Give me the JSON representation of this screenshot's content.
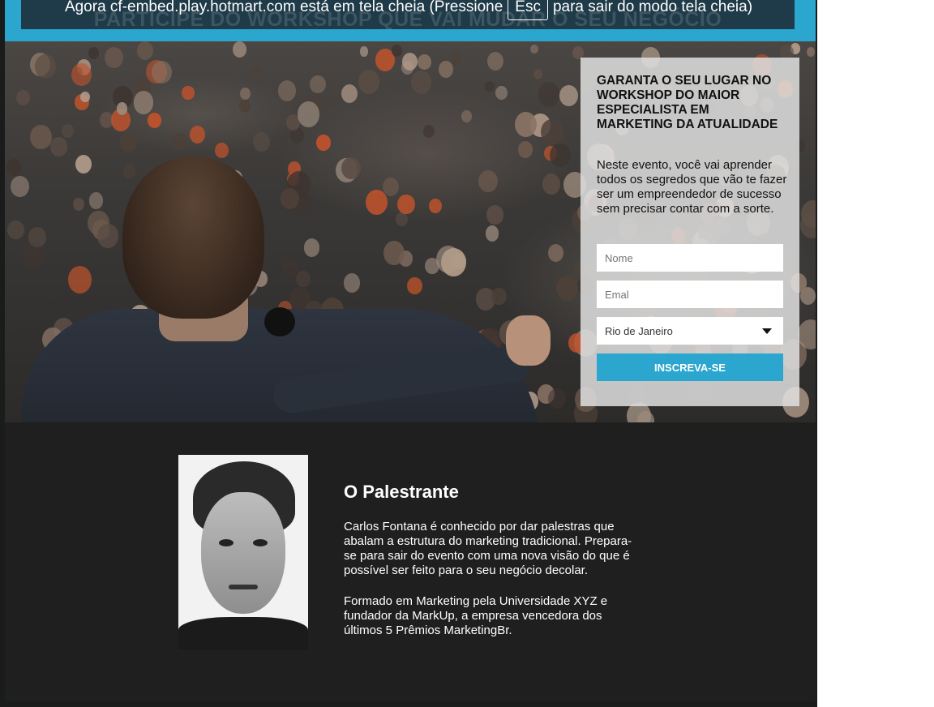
{
  "fullscreen_notice": {
    "prefix": "Agora cf-embed.play.hotmart.com está em tela cheia (Pressione",
    "key": "Esc",
    "suffix": "para sair do modo tela cheia)"
  },
  "banner": {
    "headline": "PARTICIPE DO WORKSHOP QUE VAI MUDAR O SEU NEGÓCIO"
  },
  "form": {
    "title": "GARANTA O SEU LUGAR NO WORKSHOP DO MAIOR ESPECIALISTA EM MARKETING DA ATUALIDADE",
    "description": "Neste evento, você vai aprender todos os segredos que vão te fazer ser um empreendedor de sucesso sem precisar contar com a sorte.",
    "name_placeholder": "Nome",
    "email_placeholder": "Emal",
    "city_selected": "Rio de Janeiro",
    "submit_label": "INSCREVA-SE"
  },
  "speaker": {
    "heading": "O Palestrante",
    "bio_1": "Carlos Fontana é conhecido por dar palestras que abalam a estrutura do marketing tradicional. Prepara-se para sair do evento com uma nova visão do que é possível ser feito para o seu negócio decolar.",
    "bio_2": "Formado em Marketing pela Universidade XYZ e fundador da MarkUp, a empresa vencedora dos últimos 5 Prêmios MarketingBr."
  },
  "colors": {
    "accent": "#2aa6cf",
    "dark_bg": "#1e1f1e"
  }
}
